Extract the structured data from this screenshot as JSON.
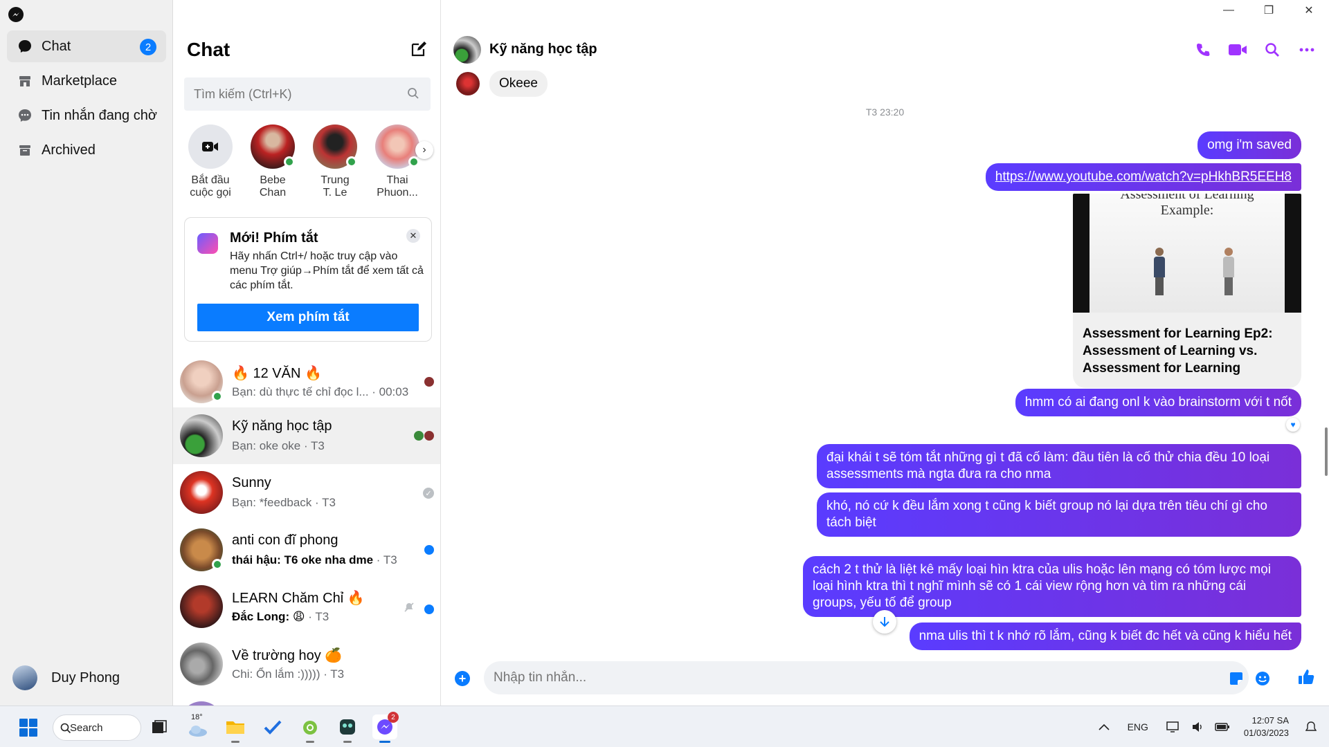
{
  "nav": {
    "items": [
      {
        "label": "Chat",
        "badge": "2"
      },
      {
        "label": "Marketplace"
      },
      {
        "label": "Tin nhắn đang chờ"
      },
      {
        "label": "Archived"
      }
    ],
    "user_name": "Duy Phong"
  },
  "chat_list": {
    "title": "Chat",
    "search_placeholder": "Tìm kiếm (Ctrl+K)",
    "stories": [
      {
        "label": "Bắt đầu\ncuộc gọi"
      },
      {
        "label": "Bebe\nChan"
      },
      {
        "label": "Trung\nT. Le"
      },
      {
        "label": "Thai\nPhuon..."
      }
    ],
    "tip": {
      "title": "Mới! Phím tắt",
      "body": "Hãy nhấn Ctrl+/ hoặc truy cập vào menu Trợ giúp→Phím tắt để xem tất cả các phím tắt.",
      "button": "Xem phím tắt"
    },
    "conversations": [
      {
        "name": "🔥 12 VĂN 🔥",
        "preview": "Bạn: dù thực tế chỉ đọc l... · 00:03",
        "online": true
      },
      {
        "name": "Kỹ năng học tập",
        "preview": "Bạn: oke oke · T3"
      },
      {
        "name": "Sunny",
        "preview": "Bạn: *feedback · T3"
      },
      {
        "name": "anti con đĩ phong",
        "preview_strong": "thái hậu: T6 oke nha dme",
        "time": " · T3",
        "online": true
      },
      {
        "name": "LEARN Chăm Chỉ 🔥",
        "preview_strong": "Đắc Long: 😩",
        "time": " · T3"
      },
      {
        "name": "Về trường hoy 🍊",
        "preview": "Chi: Ổn lắm :))))) · T3"
      }
    ]
  },
  "conversation": {
    "title": "Kỹ năng học tập",
    "incoming": "Okeee",
    "timestamp": "T3 23:20",
    "outgoing": [
      "omg i'm saved",
      "https://www.youtube.com/watch?v=pHkhBR5EEH8"
    ],
    "link_preview": {
      "slide_title": "Assessment of Learning\nExample:",
      "caption": "Assessment for Learning Ep2: Assessment of Learning vs. Assessment for Learning"
    },
    "outgoing_after": [
      "hmm có ai đang onl k vào brainstorm với t nốt",
      "đại khái t sẽ tóm tắt những gì t đã cố làm: đầu tiên là cố thử chia đều 10 loại assessments mà ngta đưa ra cho nma",
      "khó, nó cứ k đều lắm xong t cũng k biết group nó lại dựa trên tiêu chí gì cho tách biệt",
      "cách 2 t thử là liệt kê mấy loại hìn ktra của ulis hoặc lên mạng có tóm lược mọi loại hình ktra thì t nghĩ mình sẽ có 1 cái view rộng hơn và tìm ra những cái groups, yếu tố để group",
      "nma ulis thì t k nhớ rõ lắm, cũng k biết đc hết và cũng k hiểu hết"
    ],
    "composer_placeholder": "Nhập tin nhắn..."
  },
  "taskbar": {
    "search_label": "Search",
    "weather": "18°",
    "messenger_badge": "2",
    "lang": "ENG",
    "time": "12:07 SA",
    "date": "01/03/2023"
  },
  "colors": {
    "accent": "#0a7cff",
    "purple": "#a033ff",
    "online": "#31a24c"
  }
}
